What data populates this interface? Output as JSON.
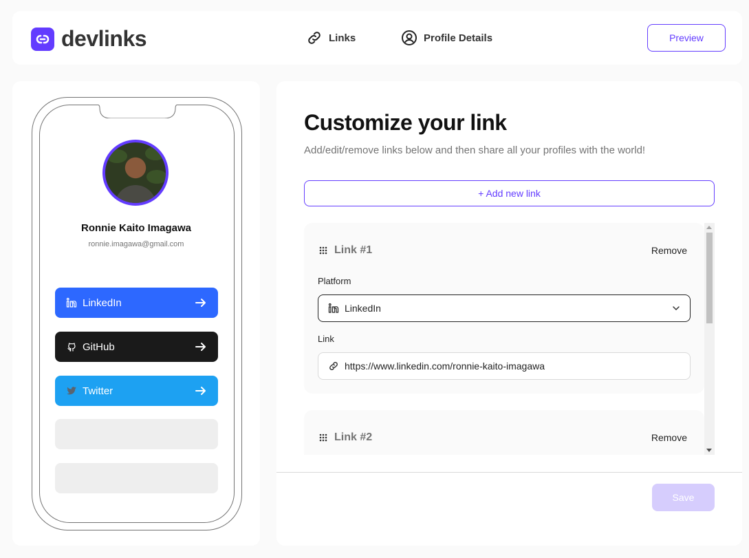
{
  "app": {
    "name": "devlinks",
    "accent_color": "#633CFF"
  },
  "nav": {
    "links_label": "Links",
    "profile_label": "Profile Details",
    "preview_label": "Preview"
  },
  "profile": {
    "name": "Ronnie Kaito Imagawa",
    "email": "ronnie.imagawa@gmail.com"
  },
  "preview_links": [
    {
      "platform": "LinkedIn",
      "color": "#2D68FF",
      "icon": "linkedin-icon"
    },
    {
      "platform": "GitHub",
      "color": "#1A1A1A",
      "icon": "github-icon"
    },
    {
      "platform": "Twitter",
      "color": "#1DA1F2",
      "icon": "twitter-icon"
    }
  ],
  "editor": {
    "title": "Customize your link",
    "subtitle": "Add/edit/remove links below and then share all your profiles with the world!",
    "add_button": "+ Add new link",
    "platform_label": "Platform",
    "link_label": "Link",
    "remove_label": "Remove",
    "links": [
      {
        "title": "Link #1",
        "platform": "LinkedIn",
        "url": "https://www.linkedin.com/ronnie-kaito-imagawa"
      },
      {
        "title": "Link #2"
      }
    ],
    "save_label": "Save"
  }
}
